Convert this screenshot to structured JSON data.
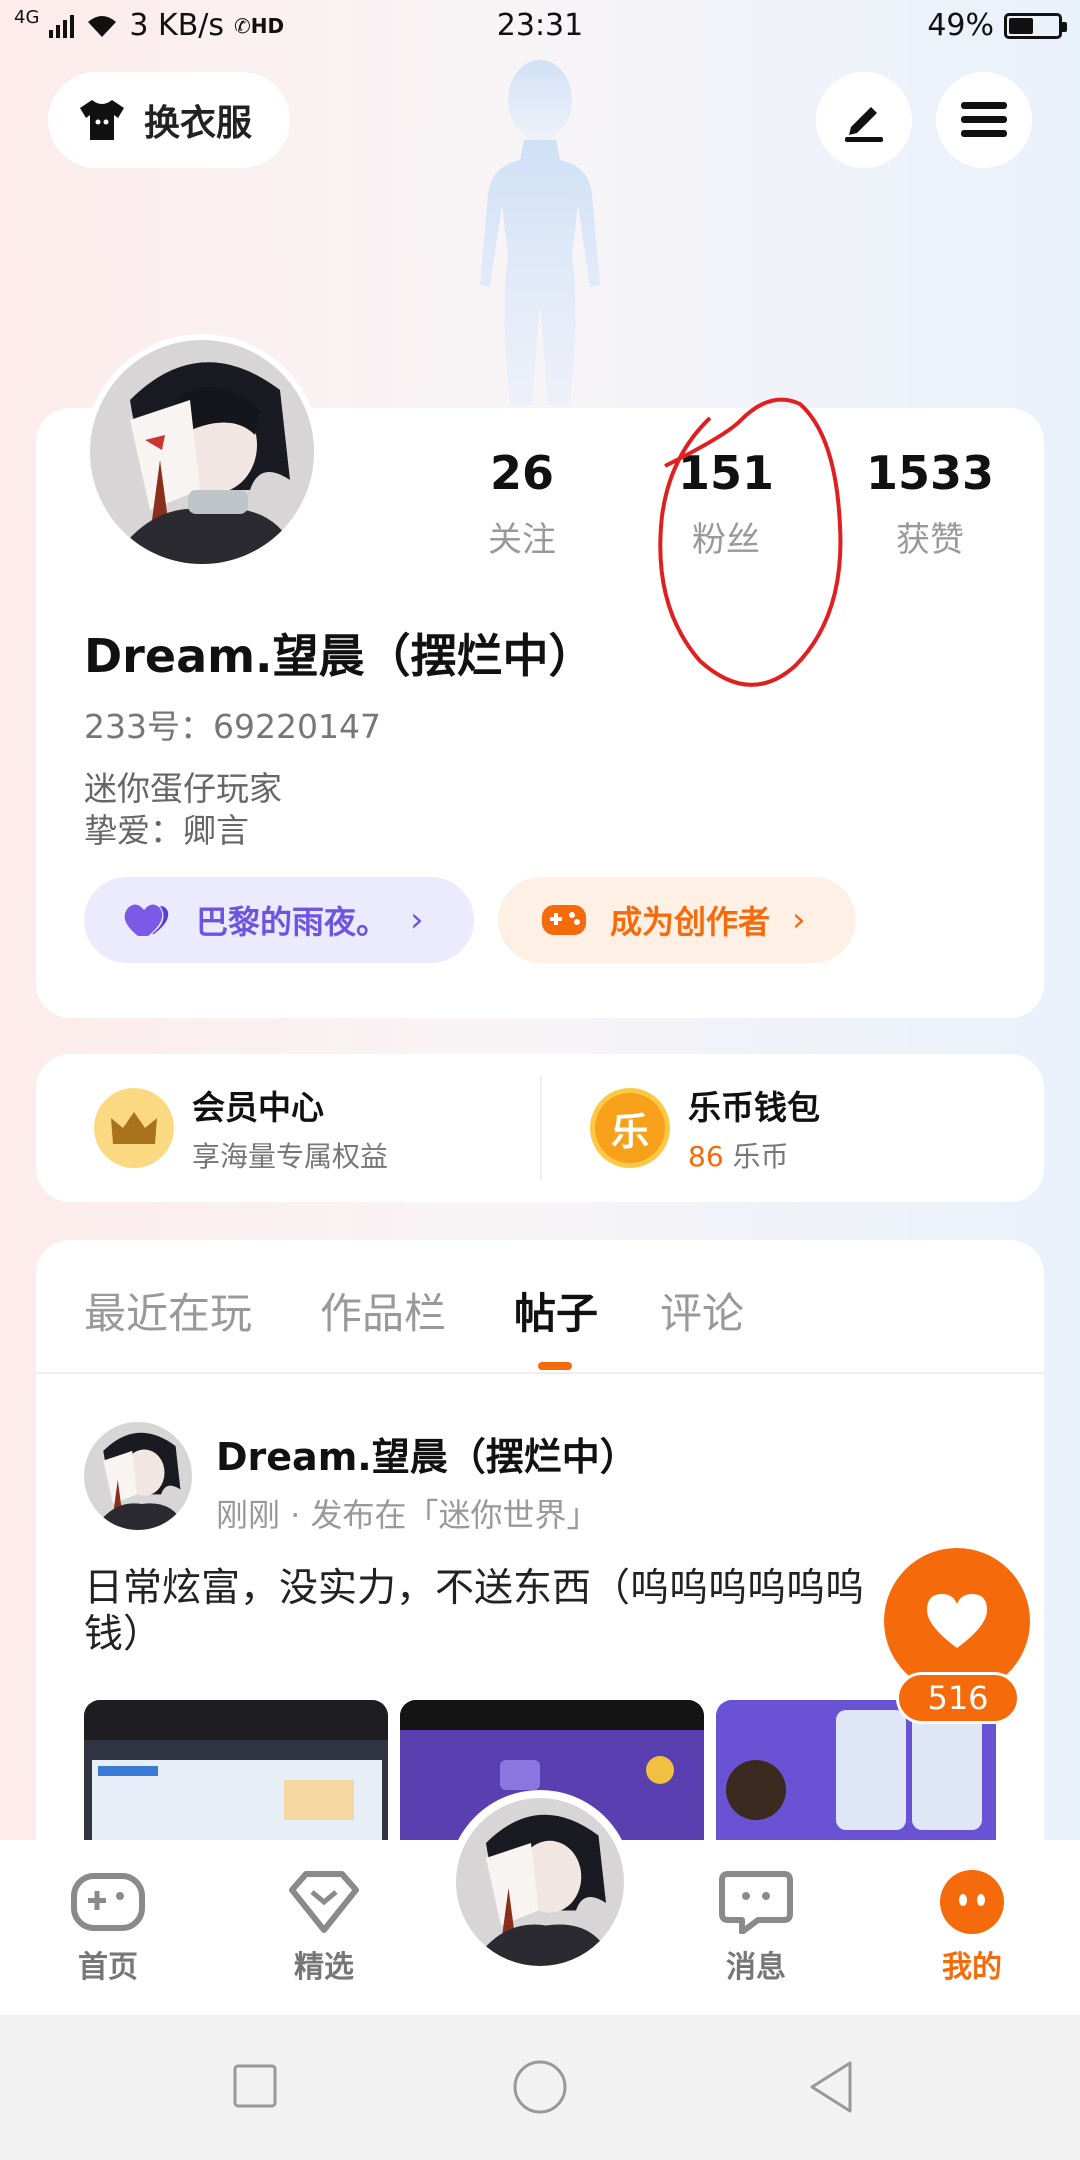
{
  "status_bar": {
    "network": "4G",
    "speed": "3 KB/s",
    "hd": "HD",
    "time": "23:31",
    "battery": "49%",
    "battery_level": 0.49
  },
  "top": {
    "dress_label": "换衣服"
  },
  "profile": {
    "stats": [
      {
        "value": "26",
        "label": "关注"
      },
      {
        "value": "151",
        "label": "粉丝"
      },
      {
        "value": "1533",
        "label": "获赞"
      }
    ],
    "name": "Dream.望晨（摆烂中）",
    "uid": "233号：69220147",
    "bio_line1": "迷你蛋仔玩家",
    "bio_line2": "挚爱：卿言",
    "love_pill": "巴黎的雨夜。",
    "creator_pill": "成为创作者"
  },
  "member": {
    "vip_title": "会员中心",
    "vip_sub": "享海量专属权益",
    "wallet_title": "乐币钱包",
    "wallet_amount": "86",
    "wallet_unit": "乐币",
    "coin_char": "乐"
  },
  "tabs": [
    {
      "label": "最近在玩"
    },
    {
      "label": "作品栏"
    },
    {
      "label": "帖子"
    },
    {
      "label": "评论"
    }
  ],
  "post": {
    "author": "Dream.望晨（摆烂中）",
    "meta": "刚刚 · 发布在「迷你世界」",
    "text": "日常炫富，没实力，不送东西（呜呜呜呜呜呜 钱）"
  },
  "like": {
    "count": "516"
  },
  "nav": [
    {
      "label": "首页"
    },
    {
      "label": "精选"
    },
    {
      "label": "消息"
    },
    {
      "label": "我的"
    }
  ],
  "colors": {
    "accent": "#f56a0b",
    "purple": "#6e55e0",
    "annotation": "#e02020"
  }
}
